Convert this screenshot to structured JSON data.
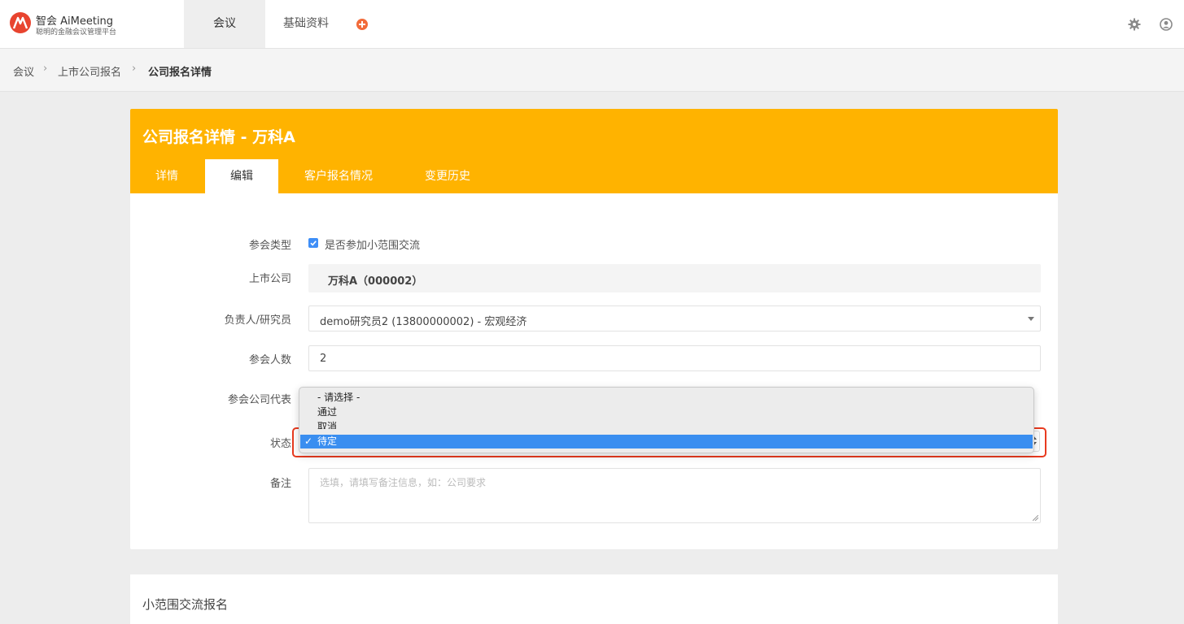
{
  "app": {
    "logo_title": "智会 AiMeeting",
    "logo_subtitle": "聪明的金融会议管理平台"
  },
  "nav": {
    "tabs": [
      {
        "label": "会议",
        "active": true
      },
      {
        "label": "基础资料",
        "active": false
      }
    ]
  },
  "breadcrumb": [
    "会议",
    "上市公司报名",
    "公司报名详情"
  ],
  "card": {
    "title": "公司报名详情 - 万科A",
    "tabs": [
      {
        "label": "详情",
        "active": false
      },
      {
        "label": "编辑",
        "active": true
      },
      {
        "label": "客户报名情况",
        "active": false
      },
      {
        "label": "变更历史",
        "active": false
      }
    ]
  },
  "form": {
    "type_label": "参会类型",
    "small_exchange_label": "是否参加小范围交流",
    "small_exchange_checked": true,
    "company_label": "上市公司",
    "company_value": "万科A（000002）",
    "owner_label": "负责人/研究员",
    "owner_value": "demo研究员2 (13800000002) - 宏观经济",
    "count_label": "参会人数",
    "count_value": "2",
    "rep_label": "参会公司代表",
    "status_label": "状态",
    "status_value": "待定",
    "remark_label": "备注",
    "remark_placeholder": "选填，请填写备注信息，如：公司要求"
  },
  "status_dropdown": {
    "options": [
      "- 请选择 -",
      "通过",
      "取消",
      "待定"
    ],
    "selected": "待定",
    "check_mark": "✓"
  },
  "section2": {
    "title": "小范围交流报名"
  },
  "colors": {
    "brand_orange": "#ffb300",
    "accent_blue": "#3a8ef0",
    "highlight_red": "#e83a1f",
    "logo_red": "#e8442f"
  }
}
